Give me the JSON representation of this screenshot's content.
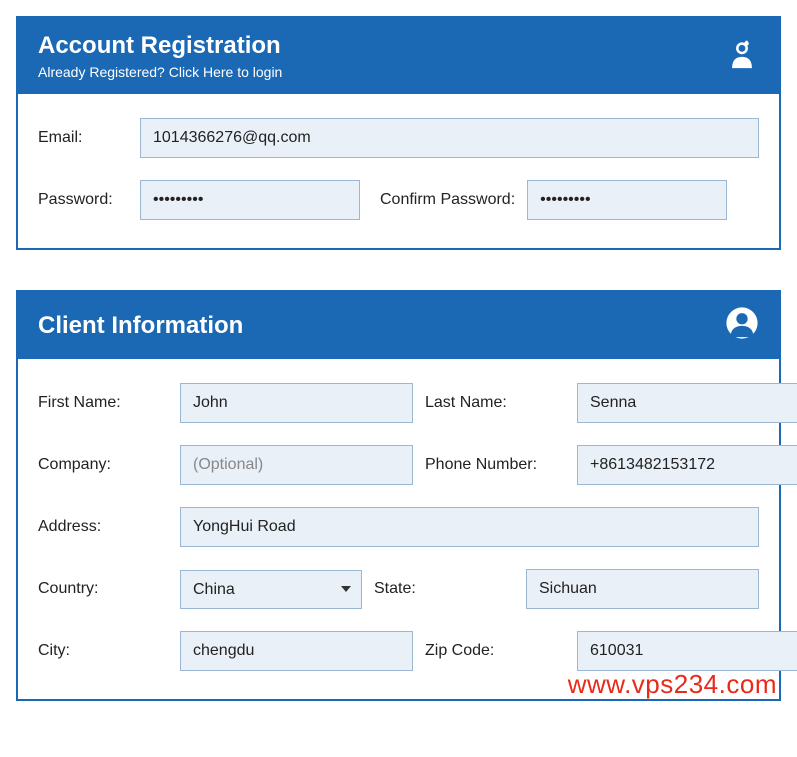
{
  "account": {
    "title": "Account Registration",
    "subtitle": "Already Registered? Click Here to login",
    "labels": {
      "email": "Email:",
      "password": "Password:",
      "confirm_password": "Confirm Password:"
    },
    "values": {
      "email": "1014366276@qq.com",
      "password": "•••••••••",
      "confirm_password": "•••••••••"
    }
  },
  "client": {
    "title": "Client Information",
    "labels": {
      "first_name": "First Name:",
      "last_name": "Last Name:",
      "company": "Company:",
      "phone": "Phone Number:",
      "address": "Address:",
      "country": "Country:",
      "state": "State:",
      "city": "City:",
      "zip": "Zip Code:"
    },
    "values": {
      "first_name": "John",
      "last_name": "Senna",
      "company": "",
      "phone": "+8613482153172",
      "address": "YongHui Road",
      "country": "China",
      "state": "Sichuan",
      "city": "chengdu",
      "zip": "610031"
    },
    "placeholders": {
      "company": "(Optional)"
    }
  },
  "watermark": "www.vps234.com"
}
